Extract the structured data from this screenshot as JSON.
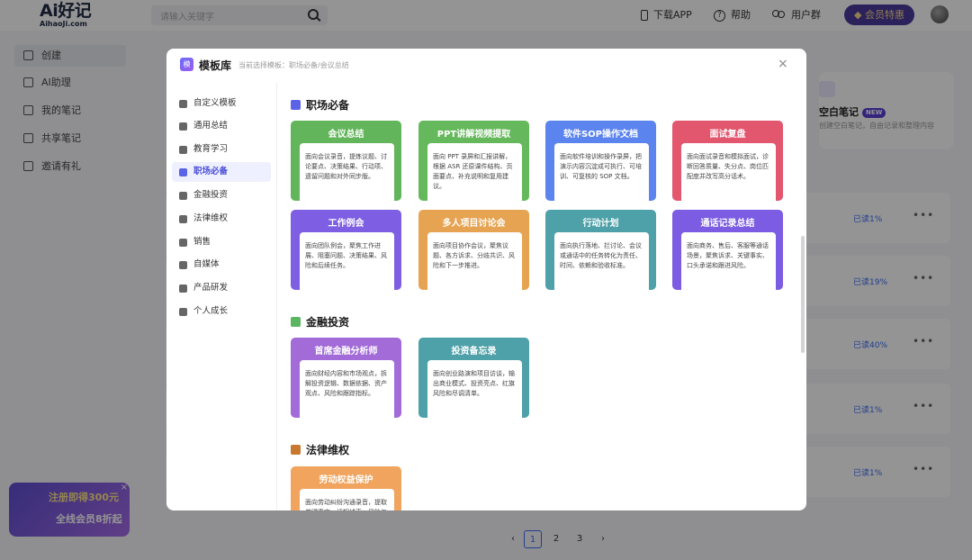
{
  "app": {
    "logo_main": "Ai好记",
    "logo_sub": "AihaoJi.com",
    "search_placeholder": "请输入关键字",
    "download": "下载APP",
    "help": "帮助",
    "user_group": "用户群",
    "vip": "会员特惠"
  },
  "sidebar": {
    "items": [
      {
        "label": "创建"
      },
      {
        "label": "AI助理"
      },
      {
        "label": "我的笔记"
      },
      {
        "label": "共享笔记"
      },
      {
        "label": "邀请有礼"
      }
    ],
    "promo": {
      "line1": "注册即得300元",
      "line2": "全线会员8折起",
      "close": "×"
    }
  },
  "background": {
    "blank_note": {
      "title": "空白笔记",
      "badge": "NEW",
      "desc": "创建空白笔记，自由记录和整理内容"
    },
    "rows": [
      {
        "status": "已读1%"
      },
      {
        "status": "已读19%"
      },
      {
        "status": "已读40%"
      },
      {
        "status": "已读1%"
      },
      {
        "status": "已读1%"
      }
    ],
    "more": "•••",
    "pager": {
      "prev": "‹",
      "pages": [
        "1",
        "2",
        "3"
      ],
      "next": "›"
    }
  },
  "modal": {
    "logo": "模",
    "title": "模板库",
    "breadcrumb": "当前选择模板：职场必备/会议总结",
    "close": "×",
    "nav": [
      {
        "label": "自定义模板"
      },
      {
        "label": "通用总结"
      },
      {
        "label": "教育学习"
      },
      {
        "label": "职场必备"
      },
      {
        "label": "金融投资"
      },
      {
        "label": "法律维权"
      },
      {
        "label": "销售"
      },
      {
        "label": "自媒体"
      },
      {
        "label": "产品研发"
      },
      {
        "label": "个人成长"
      }
    ],
    "sections": [
      {
        "title": "职场必备",
        "icon_color": "#5b63e6",
        "cards": [
          {
            "title": "会议总结",
            "desc": "面向会议录音，提炼议题、讨论要点、决策结果、行动项、遗留问题和对外同步版。",
            "color": "#62b55a"
          },
          {
            "title": "PPT讲解视频提取",
            "desc": "面向 PPT 录屏和汇报讲解，根据 ASR 还原课件结构、页面要点、补充说明和复用建议。",
            "color": "#65b85c"
          },
          {
            "title": "软件SOP操作文档",
            "desc": "面向软件培训和操作录屏，把演示内容沉淀成可执行、可培训、可复核的 SOP 文档。",
            "color": "#5b84ee"
          },
          {
            "title": "面试复盘",
            "desc": "面向面试录音和模拟面试，诊断回答质量、失分点、岗位匹配度并改写高分话术。",
            "color": "#e2566e"
          },
          {
            "title": "工作例会",
            "desc": "面向团队例会，聚焦工作进展、阻塞问题、决策结果、风险和后续任务。",
            "color": "#7e5fe3"
          },
          {
            "title": "多人项目讨论会",
            "desc": "面向项目协作会议，聚焦议题、各方诉求、分歧共识、风险和下一步推进。",
            "color": "#e6a452"
          },
          {
            "title": "行动计划",
            "desc": "面向执行落地、拦讨论、会议或通话中的任务转化为责任、时间、依赖和验收标准。",
            "color": "#4ea1a8"
          },
          {
            "title": "通话记录总结",
            "desc": "面向商务、售后、客服等通话场景，聚焦诉求、关键事实、口头承诺和跟进风险。",
            "color": "#7b5ce2"
          }
        ]
      },
      {
        "title": "金融投资",
        "icon_color": "#5cb560",
        "cards": [
          {
            "title": "首席金融分析师",
            "desc": "面向财经内容和市场观点，拆解投资逻辑、数据依据、资产观点、风险和跟踪指标。",
            "color": "#a26bd8"
          },
          {
            "title": "投资备忘录",
            "desc": "面向创业路演和项目访谈，输出商业模式、投资亮点、红旗风险和尽调清单。",
            "color": "#4ea1a8"
          }
        ]
      },
      {
        "title": "法律维权",
        "icon_color": "#c8782f",
        "cards": [
          {
            "title": "劳动权益保护",
            "desc": "面向劳动纠纷沟通录音，提取关键事实、证据线索、风险与维权建议。",
            "color": "#f0a45e"
          }
        ]
      }
    ]
  }
}
